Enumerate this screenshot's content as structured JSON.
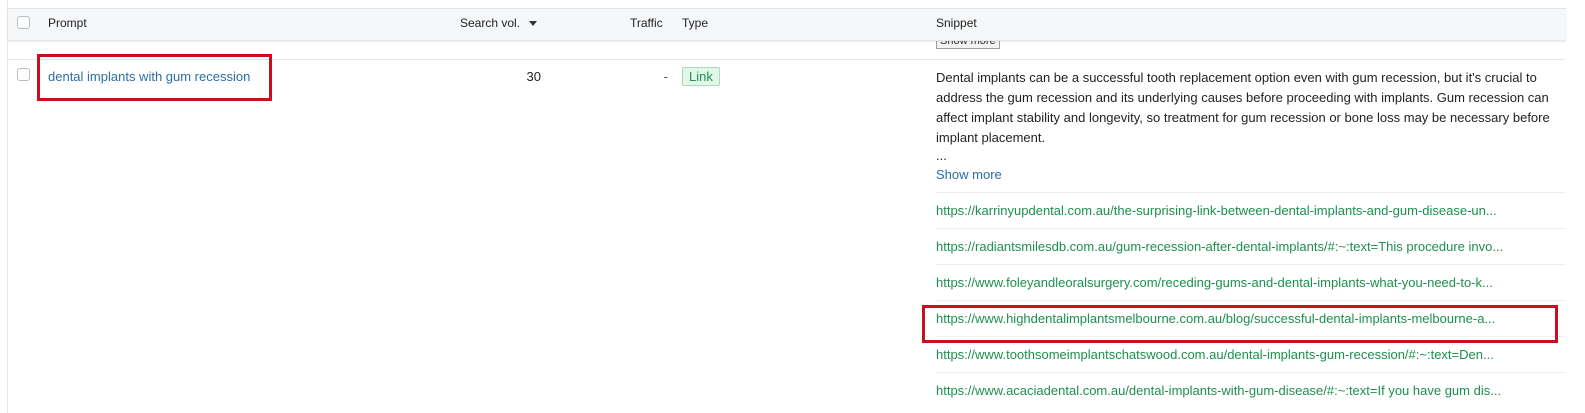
{
  "table": {
    "columns": {
      "prompt": "Prompt",
      "search_vol": "Search vol.",
      "traffic": "Traffic",
      "type": "Type",
      "snippet": "Snippet"
    },
    "prev_row": {
      "show_more_button": "Show more"
    },
    "row": {
      "prompt": "dental implants with gum recession",
      "search_vol": "30",
      "traffic": "-",
      "type": "Link",
      "snippet": "Dental implants can be a successful tooth replacement option even with gum recession, but it's crucial to address the gum recession and its underlying causes before proceeding with implants. Gum recession can affect implant stability and longevity, so treatment for gum recession or bone loss may be necessary before implant placement.",
      "ellipsis": "...",
      "show_more": "Show more",
      "links": [
        "https://karrinyupdental.com.au/the-surprising-link-between-dental-implants-and-gum-disease-un...",
        "https://radiantsmilesdb.com.au/gum-recession-after-dental-implants/#:~:text=This procedure invo...",
        "https://www.foleyandleoralsurgery.com/receding-gums-and-dental-implants-what-you-need-to-k...",
        "https://www.highdentalimplantsmelbourne.com.au/blog/successful-dental-implants-melbourne-a...",
        "https://www.toothsomeimplantschatswood.com.au/dental-implants-gum-recession/#:~:text=Den...",
        "https://www.acaciadental.com.au/dental-implants-with-gum-disease/#:~:text=If you have gum dis..."
      ]
    }
  },
  "colors": {
    "link_blue": "#2a6ea1",
    "url_green": "#1e8f4e",
    "highlight_red": "#c8101e",
    "header_bg": "#f6f7f9"
  },
  "icons": {
    "sort": "sort-desc-icon",
    "checkbox": "checkbox-icon"
  }
}
